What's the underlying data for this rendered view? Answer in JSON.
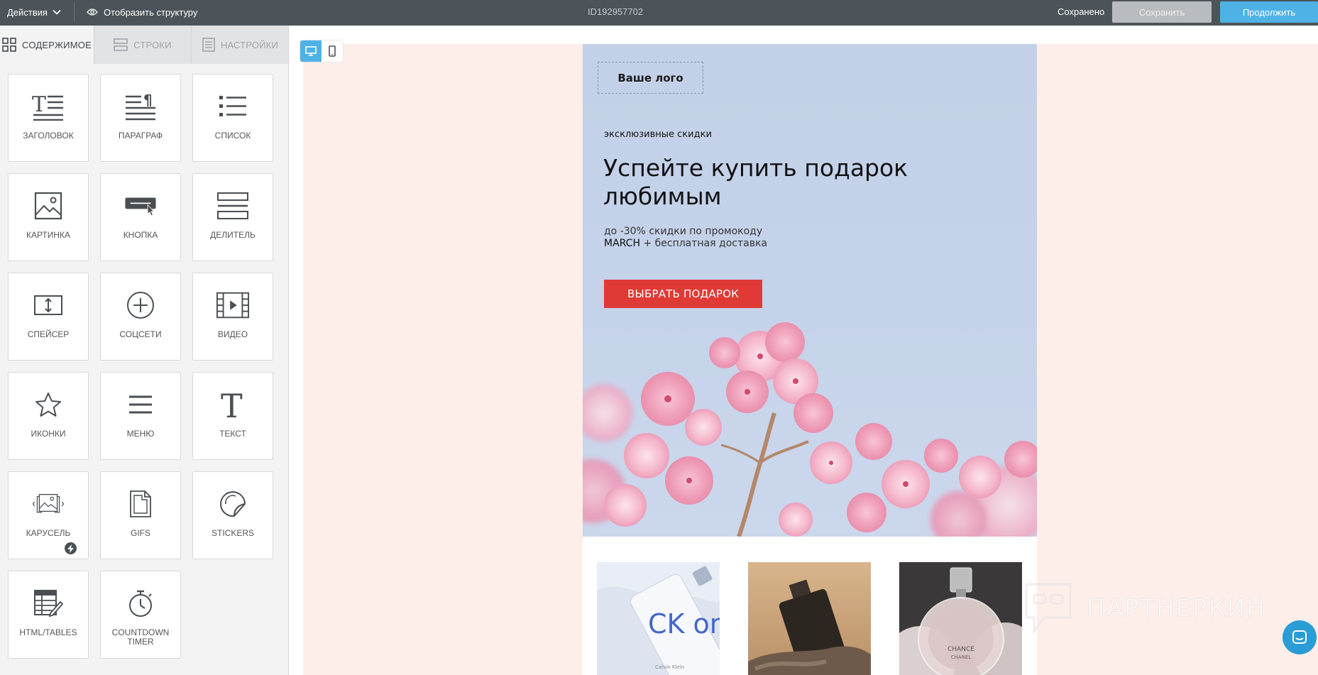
{
  "topbar": {
    "actions_label": "Действия",
    "structure_label": "Отобразить структуру",
    "template_id": "ID192957702",
    "saved_status": "Сохранено",
    "save_button": "Сохранить",
    "continue_button": "Продолжить"
  },
  "sidebar": {
    "tabs": [
      {
        "label": "СОДЕРЖИМОЕ",
        "icon": "grid-icon",
        "active": true
      },
      {
        "label": "СТРОКИ",
        "icon": "rows-icon",
        "active": false
      },
      {
        "label": "НАСТРОЙКИ",
        "icon": "settings-doc-icon",
        "active": false
      }
    ],
    "tiles": [
      {
        "label": "ЗАГОЛОВОК",
        "icon": "heading-icon"
      },
      {
        "label": "ПАРАГРАФ",
        "icon": "paragraph-icon"
      },
      {
        "label": "СПИСОК",
        "icon": "list-icon"
      },
      {
        "label": "КАРТИНКА",
        "icon": "image-icon"
      },
      {
        "label": "КНОПКА",
        "icon": "button-icon"
      },
      {
        "label": "ДЕЛИТЕЛЬ",
        "icon": "divider-icon"
      },
      {
        "label": "СПЕЙСЕР",
        "icon": "spacer-icon"
      },
      {
        "label": "СОЦСЕТИ",
        "icon": "social-icon"
      },
      {
        "label": "ВИДЕО",
        "icon": "video-icon"
      },
      {
        "label": "ИКОНКИ",
        "icon": "star-icon"
      },
      {
        "label": "МЕНЮ",
        "icon": "menu-icon"
      },
      {
        "label": "ТЕКСТ",
        "icon": "text-icon"
      },
      {
        "label": "КАРУСЕЛЬ",
        "icon": "carousel-icon",
        "badge": "bolt-icon"
      },
      {
        "label": "GIFS",
        "icon": "gifs-icon"
      },
      {
        "label": "STICKERS",
        "icon": "stickers-icon"
      },
      {
        "label": "HTML/TABLES",
        "icon": "html-tables-icon"
      },
      {
        "label": "COUNTDOWN TIMER",
        "icon": "timer-icon"
      }
    ]
  },
  "canvas": {
    "view_modes": [
      "desktop-icon",
      "mobile-icon"
    ],
    "active_view": "desktop",
    "background_color": "#fdeee9"
  },
  "email": {
    "logo_placeholder": "Ваше лого",
    "eyebrow": "эксклюзивные скидки",
    "headline": "Успейте купить подарок любимым",
    "promo_line1": "до -30% скидки по промокоду",
    "promo_code": "MARCH",
    "promo_line2_rest": " + бесплатная доставка",
    "cta_label": "ВЫБРАТЬ ПОДАРОК",
    "cta_color": "#e03a36",
    "products": [
      {
        "label": "CK one",
        "sub": "Calvin Klein"
      },
      {
        "label": "",
        "sub": ""
      },
      {
        "label": "CHANCE",
        "sub": "CHANEL"
      }
    ]
  },
  "watermark": {
    "text": "ПАРТНЕРКИН"
  },
  "colors": {
    "topbar": "#4c5459",
    "accent": "#4fb2e6",
    "cta": "#e03a36"
  }
}
